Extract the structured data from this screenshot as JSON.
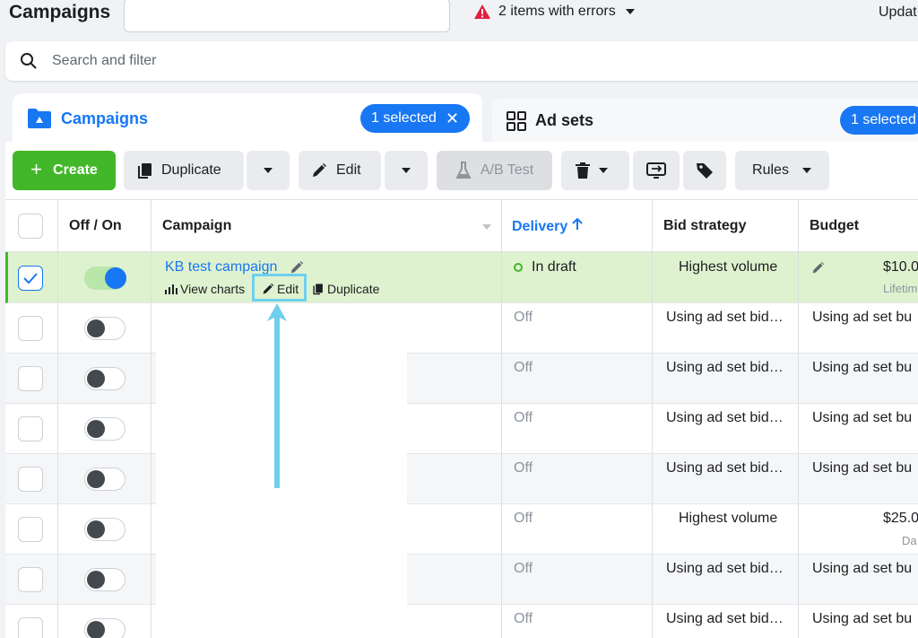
{
  "header": {
    "title": "Campaigns",
    "errors_label": "2 items with errors",
    "update_label": "Updat"
  },
  "search": {
    "placeholder": "Search and filter"
  },
  "tabs": [
    {
      "label": "Campaigns",
      "selected_label": "1 selected",
      "close": "✕"
    },
    {
      "label": "Ad sets",
      "selected_label": "1 selected"
    }
  ],
  "toolbar": {
    "create_label": "Create",
    "duplicate_label": "Duplicate",
    "edit_label": "Edit",
    "ab_test_label": "A/B Test",
    "rules_label": "Rules"
  },
  "table": {
    "columns": [
      "Off / On",
      "Campaign",
      "Delivery",
      "Bid strategy",
      "Budget"
    ],
    "selected_row": {
      "campaign_name": "KB test campaign",
      "view_charts": "View charts",
      "edit": "Edit",
      "duplicate": "Duplicate",
      "delivery": "In draft",
      "bid_strategy": "Highest volume",
      "budget": "$10.0",
      "budget_type": "Lifetim"
    },
    "rows": [
      {
        "delivery": "Off",
        "bid_strategy": "Using ad set bid…",
        "budget": "Using ad set bu",
        "budget_type": ""
      },
      {
        "delivery": "Off",
        "bid_strategy": "Using ad set bid…",
        "budget": "Using ad set bu",
        "budget_type": ""
      },
      {
        "delivery": "Off",
        "bid_strategy": "Using ad set bid…",
        "budget": "Using ad set bu",
        "budget_type": ""
      },
      {
        "delivery": "Off",
        "bid_strategy": "Using ad set bid…",
        "budget": "Using ad set bu",
        "budget_type": ""
      },
      {
        "delivery": "Off",
        "bid_strategy": "Highest volume",
        "budget": "$25.0",
        "budget_type": "Da"
      },
      {
        "delivery": "Off",
        "bid_strategy": "Using ad set bid…",
        "budget": "Using ad set bu",
        "budget_type": ""
      },
      {
        "delivery": "Off",
        "bid_strategy": "Using ad set bid…",
        "budget": "Using ad set bu",
        "budget_type": ""
      }
    ]
  },
  "colors": {
    "accent": "#1877f2",
    "create_green": "#42b72a",
    "selected_row": "#dff2cf",
    "highlight": "#6fd0ee"
  }
}
